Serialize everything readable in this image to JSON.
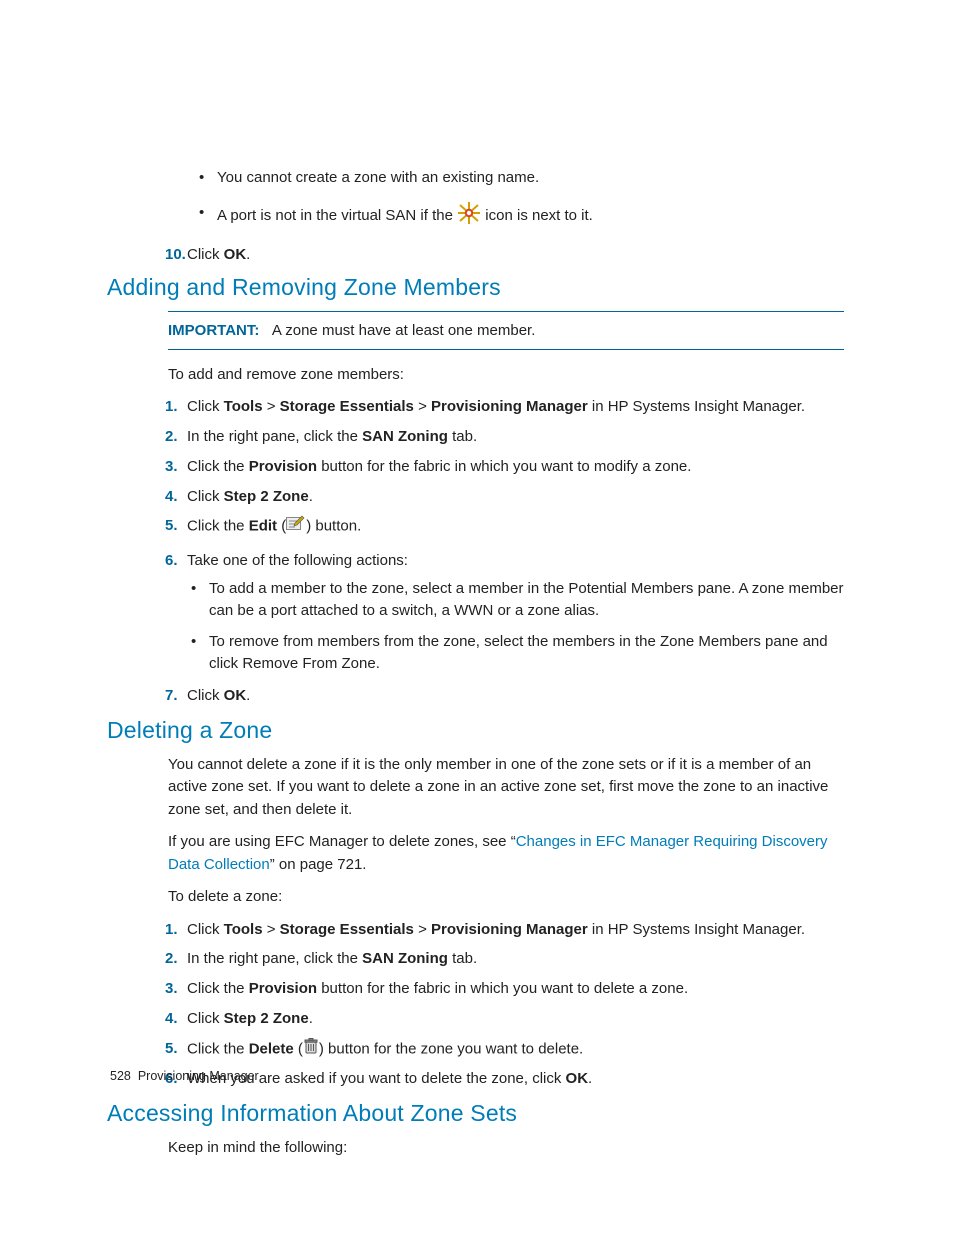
{
  "topBullets": {
    "b1": "You cannot create a zone with an existing name.",
    "b2_pre": "A port is not in the virtual SAN if the ",
    "b2_post": " icon is next to it."
  },
  "step10": {
    "marker": "10.",
    "pre": "Click ",
    "ok": "OK",
    "post": "."
  },
  "h1": "Adding and Removing Zone Members",
  "important": {
    "label": "IMPORTANT:",
    "text": "A zone must have at least one member."
  },
  "intro1": "To add and remove zone members:",
  "steps1": {
    "s1": {
      "marker": "1.",
      "pre": "Click ",
      "b1": "Tools",
      "sep1": " > ",
      "b2": "Storage Essentials",
      "sep2": " > ",
      "b3": "Provisioning Manager",
      "post": " in HP Systems Insight Manager."
    },
    "s2": {
      "marker": "2.",
      "pre": "In the right pane, click the ",
      "b1": "SAN Zoning",
      "post": " tab."
    },
    "s3": {
      "marker": "3.",
      "pre": "Click the ",
      "b1": "Provision",
      "post": " button for the fabric in which you want to modify a zone."
    },
    "s4": {
      "marker": "4.",
      "pre": "Click ",
      "b1": "Step 2 Zone",
      "post": "."
    },
    "s5": {
      "marker": "5.",
      "pre": "Click the ",
      "b1": "Edit",
      "post_open": " (",
      "post_close": ") button."
    },
    "s6": {
      "marker": "6.",
      "text": "Take one of the following actions:"
    },
    "s6a": "To add a member to the zone, select a member in the Potential Members pane. A zone member can be a port attached to a switch, a WWN or a zone alias.",
    "s6b": "To remove from members from the zone, select the members in the Zone Members pane and click Remove From Zone.",
    "s7": {
      "marker": "7.",
      "pre": "Click ",
      "b1": "OK",
      "post": "."
    }
  },
  "h2": "Deleting a Zone",
  "deletePara1": "You cannot delete a zone if it is the only member in one of the zone sets or if it is a member of an active zone set. If you want to delete a zone in an active zone set, first move the zone to an inactive zone set, and then delete it.",
  "deletePara2_pre": "If you are using EFC Manager to delete zones, see “",
  "deletePara2_link": "Changes in EFC Manager Requiring Discovery Data Collection",
  "deletePara2_post": "” on page 721.",
  "intro2": "To delete a zone:",
  "steps2": {
    "s1": {
      "marker": "1.",
      "pre": "Click ",
      "b1": "Tools",
      "sep1": " > ",
      "b2": "Storage Essentials",
      "sep2": " > ",
      "b3": "Provisioning Manager",
      "post": " in HP Systems Insight Manager."
    },
    "s2": {
      "marker": "2.",
      "pre": "In the right pane, click the ",
      "b1": "SAN Zoning",
      "post": " tab."
    },
    "s3": {
      "marker": "3.",
      "pre": "Click the ",
      "b1": "Provision",
      "post": " button for the fabric in which you want to delete a zone."
    },
    "s4": {
      "marker": "4.",
      "pre": "Click ",
      "b1": "Step 2 Zone",
      "post": "."
    },
    "s5": {
      "marker": "5.",
      "pre": "Click the ",
      "b1": "Delete",
      "post_open": " (",
      "post_close": ") button for the zone you want to delete."
    },
    "s6": {
      "marker": "6.",
      "pre": "When you are asked if you want to delete the zone, click ",
      "b1": "OK",
      "post": "."
    }
  },
  "h3": "Accessing Information About Zone Sets",
  "zsPara": "Keep in mind the following:",
  "footer": {
    "page": "528",
    "title": "Provisioning Manager"
  }
}
